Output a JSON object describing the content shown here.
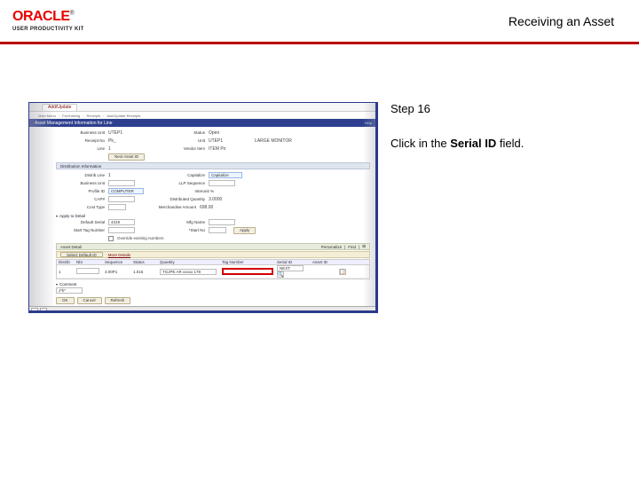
{
  "header": {
    "logo_text": "ORACLE",
    "logo_tm": "®",
    "logo_sub": "USER PRODUCTIVITY KIT",
    "title": "Receiving an Asset"
  },
  "instruction": {
    "step": "Step 16",
    "line1_pre": "Click in the ",
    "line1_bold": "Serial ID",
    "line1_post": " field."
  },
  "screenshot": {
    "tab": "Add/Update",
    "crumbs": [
      "Main Menu",
      "Purchasing",
      "Receipts",
      "Add/Update Receipts"
    ],
    "winTitle": "Asset Management Information for Line",
    "help": "Help",
    "topRow1": {
      "businessUnit": "Business Unit",
      "businessUnitVal": "UTEP1",
      "status": "Status",
      "statusVal": "Open"
    },
    "topRow2": {
      "receiptNo": "Receipt No",
      "receiptNoVal": "Pk_",
      "unitPO": "Unit",
      "unitPOVal": "UTEP1",
      "labelMid": "LARGE MONITOR"
    },
    "topRow3": {
      "line": "Line",
      "lineVal": "1",
      "vendorPO": "Vendor Item",
      "vendorPOVal": "ITEM Po"
    },
    "nextAssetBtn": "Next Asset ID",
    "distSection": "Distribution Information",
    "distRows": {
      "distSeq": "Distrib Line",
      "distSeqVal": "1",
      "capStatus": "Capitalize",
      "capStatusVal": "Capitalize",
      "bu": "Business Unit",
      "buVal": "",
      "lppSeq": "LLP Sequence",
      "lppSeqVal": "",
      "profile": "Profile ID",
      "profileVal": "COMPUTER",
      "inter": "Interunit %",
      "interVal": "",
      "cap": "CAP#",
      "capVal": "",
      "distQty": "Distributed Quantity",
      "distQtyVal": "3.0000",
      "costType": "Cost Type",
      "costTypeVal": "",
      "merchAmt": "Merchandise Amount",
      "merchAmtVal": "698.00"
    },
    "applyTitle": "Apply to Detail",
    "applyRows": {
      "defaultSer": "Default Serial",
      "defaultSerVal": "4319",
      "defaultMfg": "Mfg Name",
      "defaultMfgVal": "",
      "startTag": "Start Tag Number",
      "startTagVal": "",
      "startNo": "*Start No",
      "startNoVal": "",
      "applyBtn": "Apply"
    },
    "override": "Override existing numbers",
    "detailSection": "Asset Detail",
    "detailButtons": {
      "sel": "Select Default ID",
      "more": "More Details"
    },
    "detailRight": {
      "pers": "Personalize",
      "find": "Find",
      "grid": "⊞"
    },
    "detailCols": [
      "Distrib",
      "Nbr",
      "Sequence",
      "Status",
      "Quantity",
      "Tag Number",
      "Serial ID",
      "Asset ID",
      ""
    ],
    "detailRow": {
      "dist": "1",
      "nbr": "",
      "seq": "3.00P1",
      "stat": "1.016",
      "qty": "",
      "tag": "TGJPE AR xxxxx 178",
      "serial": "",
      "asset": "NEXT",
      "cal": "📋"
    },
    "commentSection": "Comment",
    "commentJ": "J*k*",
    "bottomButtons": [
      "OK",
      "Cancel",
      "Refresh"
    ]
  }
}
